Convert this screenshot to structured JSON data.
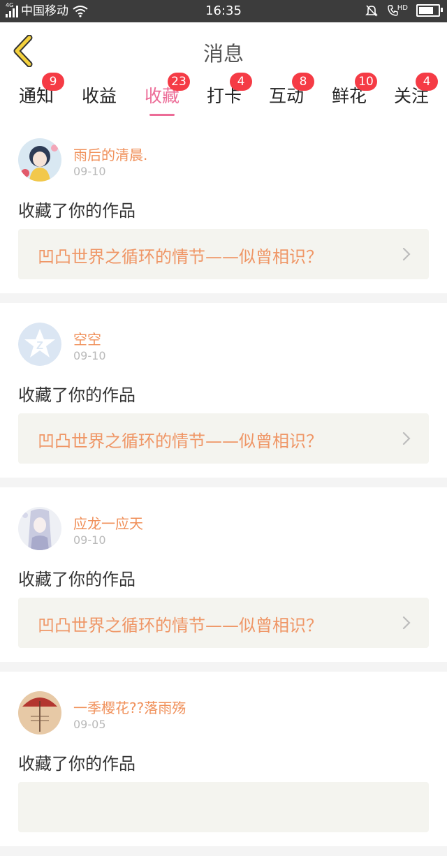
{
  "status_bar": {
    "network": "4G",
    "carrier": "中国移动",
    "time": "16:35",
    "hd": "HD"
  },
  "header": {
    "title": "消息"
  },
  "tabs": [
    {
      "label": "通知",
      "badge": "9"
    },
    {
      "label": "收益",
      "badge": ""
    },
    {
      "label": "收藏",
      "badge": "23",
      "active": true
    },
    {
      "label": "打卡",
      "badge": "4"
    },
    {
      "label": "互动",
      "badge": "8"
    },
    {
      "label": "鲜花",
      "badge": "10"
    },
    {
      "label": "关注",
      "badge": "4"
    }
  ],
  "items": [
    {
      "user": "雨后的清晨.",
      "date": "09-10",
      "action": "收藏了你的作品",
      "work": "凹凸世界之循环的情节——似曾相识？"
    },
    {
      "user": "空空",
      "date": "09-10",
      "action": "收藏了你的作品",
      "work": "凹凸世界之循环的情节——似曾相识？"
    },
    {
      "user": "应龙一应天",
      "date": "09-10",
      "action": "收藏了你的作品",
      "work": "凹凸世界之循环的情节——似曾相识？"
    },
    {
      "user": "一季樱花??落雨殇",
      "date": "09-05",
      "action": "收藏了你的作品",
      "work": ""
    }
  ],
  "colors": {
    "accent": "#ec6c97",
    "badge": "#f53b45",
    "username": "#f0905a",
    "work_title": "#ef9666"
  }
}
